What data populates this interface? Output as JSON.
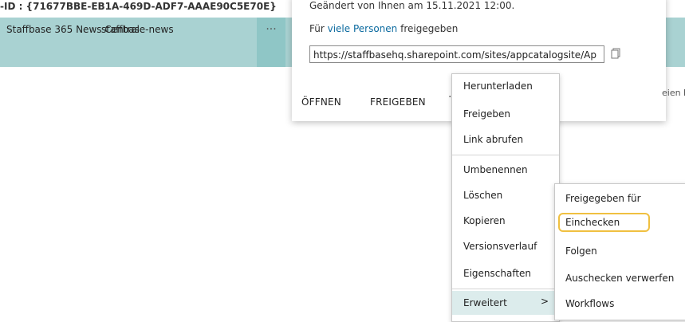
{
  "header": {
    "id_line": "-ID : {71677BBE-EB1A-469D-ADF7-AAAE90C5E70E}"
  },
  "row": {
    "name": "Staffbase 365 News Central",
    "internal_name": "staffbase-news",
    "more_label": "..."
  },
  "callout": {
    "modified": "Geändert von Ihnen am 15.11.2021 12:00.",
    "shared_prefix": "Für ",
    "shared_link": "viele Personen",
    "shared_suffix": " freigegeben",
    "url": "https://staffbasehq.sharepoint.com/sites/appcatalogsite/Ap",
    "open_label": "ÖFFNEN",
    "share_label": "FREIGEBEN",
    "more_label": "···"
  },
  "side_text": "eien hierh",
  "menu": {
    "items": [
      "Herunterladen",
      "Freigeben",
      "Link abrufen",
      "Umbenennen",
      "Löschen",
      "Kopieren",
      "Versionsverlauf",
      "Eigenschaften"
    ],
    "advanced_label": "Erweitert",
    "advanced_chevron": ">"
  },
  "submenu": {
    "items": [
      "Freigegeben für",
      "Einchecken",
      "Folgen",
      "Auschecken verwerfen",
      "Workflows"
    ]
  },
  "colors": {
    "selected_row": "#a9d2d2",
    "highlight_ring": "#f0c040",
    "link": "#0b6a9f"
  }
}
